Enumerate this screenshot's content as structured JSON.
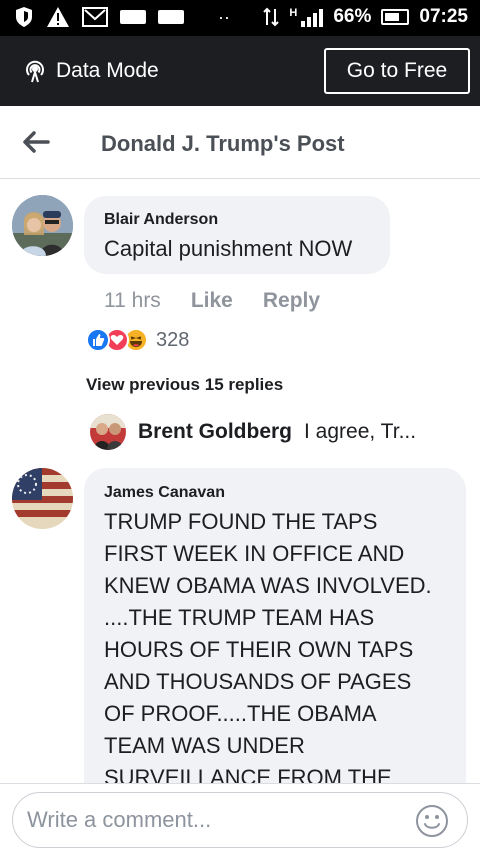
{
  "status_bar": {
    "battery_percent": "66%",
    "time": "07:25",
    "network": "H"
  },
  "data_mode": {
    "label": "Data Mode",
    "go_free_label": "Go to Free"
  },
  "header": {
    "title": "Donald J. Trump's Post"
  },
  "comments": [
    {
      "author": "Blair Anderson",
      "text": "Capital punishment NOW",
      "time": "11 hrs",
      "like_label": "Like",
      "reply_label": "Reply",
      "reaction_count": "328",
      "reactions": [
        "like-icon",
        "love-icon",
        "haha-icon"
      ]
    },
    {
      "author": "James Canavan",
      "text_lines": [
        "TRUMP FOUND THE TAPS",
        "FIRST WEEK IN OFFICE AND",
        "KNEW OBAMA WAS INVOLVED.",
        "....THE TRUMP TEAM HAS",
        "HOURS OF THEIR OWN TAPS",
        "AND THOUSANDS OF PAGES",
        "OF PROOF.....THE OBAMA",
        "TEAM WAS UNDER",
        "SURVEILLANCE FROM THE"
      ]
    }
  ],
  "replies": {
    "view_previous_label": "View previous 15 replies",
    "latest_author": "Brent Goldberg",
    "latest_snippet": "I agree, Tr..."
  },
  "composer": {
    "placeholder": "Write a comment..."
  },
  "colors": {
    "status_bar": "#000000",
    "data_bar": "#1c1e21",
    "bubble": "#f0f2f5",
    "like_blue": "#1877f2",
    "love_red": "#f33e58",
    "haha_yellow": "#f7b125"
  }
}
